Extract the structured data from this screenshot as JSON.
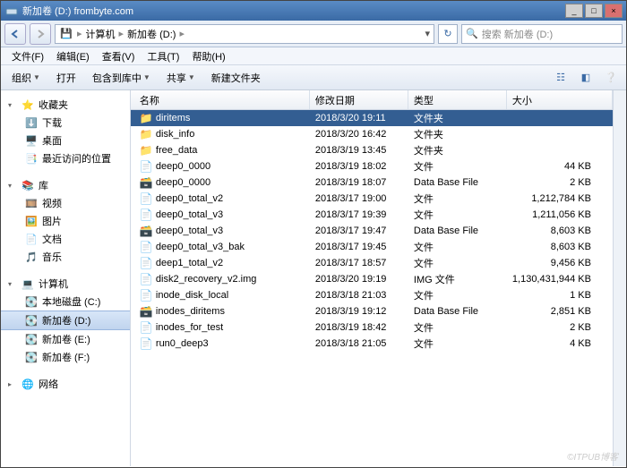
{
  "window": {
    "title": "新加卷 (D:) frombyte.com",
    "min": "_",
    "max": "□",
    "close": "×"
  },
  "breadcrumb": {
    "p1": "计算机",
    "p2": "新加卷 (D:)",
    "sep": "▸",
    "refresh": "↻"
  },
  "search": {
    "placeholder": "搜索 新加卷 (D:)"
  },
  "menus": [
    "文件(F)",
    "编辑(E)",
    "查看(V)",
    "工具(T)",
    "帮助(H)"
  ],
  "toolbar": {
    "org": "组织",
    "open": "打开",
    "include": "包含到库中",
    "share": "共享",
    "newfolder": "新建文件夹"
  },
  "sidebar": {
    "fav": {
      "label": "收藏夹",
      "items": [
        "下载",
        "桌面",
        "最近访问的位置"
      ]
    },
    "lib": {
      "label": "库",
      "items": [
        "视频",
        "图片",
        "文档",
        "音乐"
      ]
    },
    "comp": {
      "label": "计算机",
      "items": [
        "本地磁盘 (C:)",
        "新加卷 (D:)",
        "新加卷 (E:)",
        "新加卷 (F:)"
      ]
    },
    "net": {
      "label": "网络"
    }
  },
  "columns": {
    "name": "名称",
    "date": "修改日期",
    "type": "类型",
    "size": "大小"
  },
  "files": [
    {
      "name": "diritems",
      "date": "2018/3/20 19:11",
      "type": "文件夹",
      "size": "",
      "icon": "folder",
      "sel": true
    },
    {
      "name": "disk_info",
      "date": "2018/3/20 16:42",
      "type": "文件夹",
      "size": "",
      "icon": "folder"
    },
    {
      "name": "free_data",
      "date": "2018/3/19 13:45",
      "type": "文件夹",
      "size": "",
      "icon": "folder"
    },
    {
      "name": "deep0_0000",
      "date": "2018/3/19 18:02",
      "type": "文件",
      "size": "44 KB",
      "icon": "file"
    },
    {
      "name": "deep0_0000",
      "date": "2018/3/19 18:07",
      "type": "Data Base File",
      "size": "2 KB",
      "icon": "db"
    },
    {
      "name": "deep0_total_v2",
      "date": "2018/3/17 19:00",
      "type": "文件",
      "size": "1,212,784 KB",
      "icon": "file"
    },
    {
      "name": "deep0_total_v3",
      "date": "2018/3/17 19:39",
      "type": "文件",
      "size": "1,211,056 KB",
      "icon": "file"
    },
    {
      "name": "deep0_total_v3",
      "date": "2018/3/17 19:47",
      "type": "Data Base File",
      "size": "8,603 KB",
      "icon": "db"
    },
    {
      "name": "deep0_total_v3_bak",
      "date": "2018/3/17 19:45",
      "type": "文件",
      "size": "8,603 KB",
      "icon": "file"
    },
    {
      "name": "deep1_total_v2",
      "date": "2018/3/17 18:57",
      "type": "文件",
      "size": "9,456 KB",
      "icon": "file"
    },
    {
      "name": "disk2_recovery_v2.img",
      "date": "2018/3/20 19:19",
      "type": "IMG 文件",
      "size": "1,130,431,944 KB",
      "icon": "file"
    },
    {
      "name": "inode_disk_local",
      "date": "2018/3/18 21:03",
      "type": "文件",
      "size": "1 KB",
      "icon": "file"
    },
    {
      "name": "inodes_diritems",
      "date": "2018/3/19 19:12",
      "type": "Data Base File",
      "size": "2,851 KB",
      "icon": "db"
    },
    {
      "name": "inodes_for_test",
      "date": "2018/3/19 18:42",
      "type": "文件",
      "size": "2 KB",
      "icon": "file"
    },
    {
      "name": "run0_deep3",
      "date": "2018/3/18 21:05",
      "type": "文件",
      "size": "4 KB",
      "icon": "file"
    }
  ],
  "watermark": "©ITPUB博客"
}
